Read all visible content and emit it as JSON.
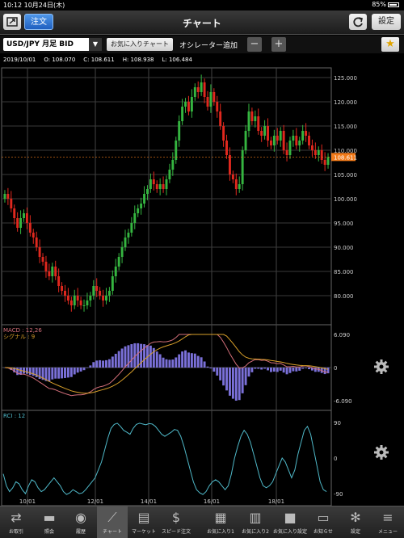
{
  "status": {
    "time": "10:12",
    "date": "10月24日(木)",
    "battery": "85%"
  },
  "nav": {
    "title": "チャート",
    "order_label": "注文",
    "setting_label": "設定"
  },
  "toolbar": {
    "pair": "USD/JPY 月足 BID",
    "favorite_label": "お気に入りチャート",
    "oscillator_label": "オシレーター追加",
    "minus": "−",
    "plus": "+",
    "star": "★"
  },
  "info": {
    "date": "2019/10/01",
    "open": "O: 108.070",
    "close": "C: 108.611",
    "high": "H: 108.938",
    "low": "L: 106.484"
  },
  "colors": {
    "up": "#35b540",
    "down": "#e0281e",
    "macd": "#d46f7a",
    "signal": "#d9a02a",
    "rci": "#4fb8c8",
    "hist": "#7a70d8",
    "price_tag": "#f07a1a"
  },
  "chart_data": [
    {
      "type": "candlestick",
      "ylim": [
        74,
        127
      ],
      "yticks": [
        "125.000",
        "120.000",
        "115.000",
        "110.000",
        "105.000",
        "100.000",
        "95.000",
        "90.000",
        "85.000",
        "80.000"
      ],
      "current_price_label": "108.611",
      "current_price": 108.611,
      "closes": [
        101,
        100,
        98,
        96,
        94,
        96,
        97,
        95,
        93,
        92,
        90,
        88,
        87,
        85,
        84,
        86,
        84,
        82,
        81,
        80,
        79,
        78,
        80,
        79,
        78,
        78,
        79,
        80,
        82,
        81,
        80,
        79,
        80,
        81,
        84,
        86,
        88,
        90,
        92,
        93,
        95,
        97,
        98,
        99,
        101,
        102,
        104,
        103,
        102,
        103,
        102,
        104,
        106,
        108,
        112,
        116,
        119,
        120,
        118,
        121,
        123,
        122,
        124,
        121,
        119,
        122,
        120,
        118,
        115,
        112,
        109,
        105,
        104,
        102,
        103,
        110,
        114,
        118,
        116,
        117,
        114,
        113,
        115,
        112,
        111,
        113,
        112,
        114,
        110,
        109,
        112,
        113,
        111,
        112,
        114,
        113,
        111,
        110,
        109,
        110,
        108,
        107,
        108.6
      ]
    },
    {
      "type": "macd",
      "title": "MACD : 12,26",
      "signal_title": "シグナル : 9",
      "ylim": [
        -6.09,
        6.09
      ],
      "yticks": [
        "6.090",
        "0",
        "-6.090"
      ]
    },
    {
      "type": "line",
      "title": "RCI : 12",
      "ylim": [
        -100,
        100
      ],
      "yticks": [
        "90",
        "0",
        "-90"
      ],
      "values": [
        -40,
        -70,
        -85,
        -75,
        -60,
        -65,
        -80,
        -90,
        -70,
        -55,
        -60,
        -75,
        -85,
        -80,
        -70,
        -60,
        -50,
        -60,
        -70,
        -85,
        -92,
        -88,
        -80,
        -85,
        -90,
        -88,
        -80,
        -70,
        -60,
        -50,
        -30,
        -10,
        20,
        50,
        75,
        85,
        88,
        80,
        70,
        65,
        60,
        75,
        85,
        88,
        86,
        84,
        87,
        86,
        80,
        70,
        60,
        55,
        60,
        65,
        72,
        70,
        55,
        30,
        0,
        -30,
        -60,
        -80,
        -88,
        -92,
        -85,
        -70,
        -60,
        -55,
        -60,
        -70,
        -80,
        -70,
        -40,
        0,
        30,
        55,
        70,
        60,
        40,
        10,
        -20,
        -50,
        -70,
        -75,
        -70,
        -60,
        -40,
        -20,
        0,
        -10,
        -30,
        -50,
        -30,
        10,
        40,
        70,
        80,
        60,
        20,
        -20,
        -60,
        -80,
        -85
      ]
    },
    {
      "type": "axis",
      "xticks": [
        "10/01",
        "12/01",
        "14/01",
        "16/01",
        "18/01"
      ]
    }
  ],
  "tabs": [
    {
      "label": "お取引",
      "icon": "exchange-icon"
    },
    {
      "label": "照会",
      "icon": "folder-icon"
    },
    {
      "label": "履歴",
      "icon": "clock-icon"
    },
    {
      "label": "チャート",
      "icon": "chart-icon"
    },
    {
      "label": "マーケット",
      "icon": "market-icon"
    },
    {
      "label": "スピード注文",
      "icon": "speed-icon"
    },
    {
      "label": "お気に入り1",
      "icon": "grid-icon"
    },
    {
      "label": "お気に入り2",
      "icon": "panel-icon"
    },
    {
      "label": "お気に入り設定",
      "icon": "fav-setting-icon"
    },
    {
      "label": "お知らせ",
      "icon": "message-icon"
    },
    {
      "label": "設定",
      "icon": "gear-icon"
    },
    {
      "label": "メニュー",
      "icon": "menu-icon"
    }
  ]
}
